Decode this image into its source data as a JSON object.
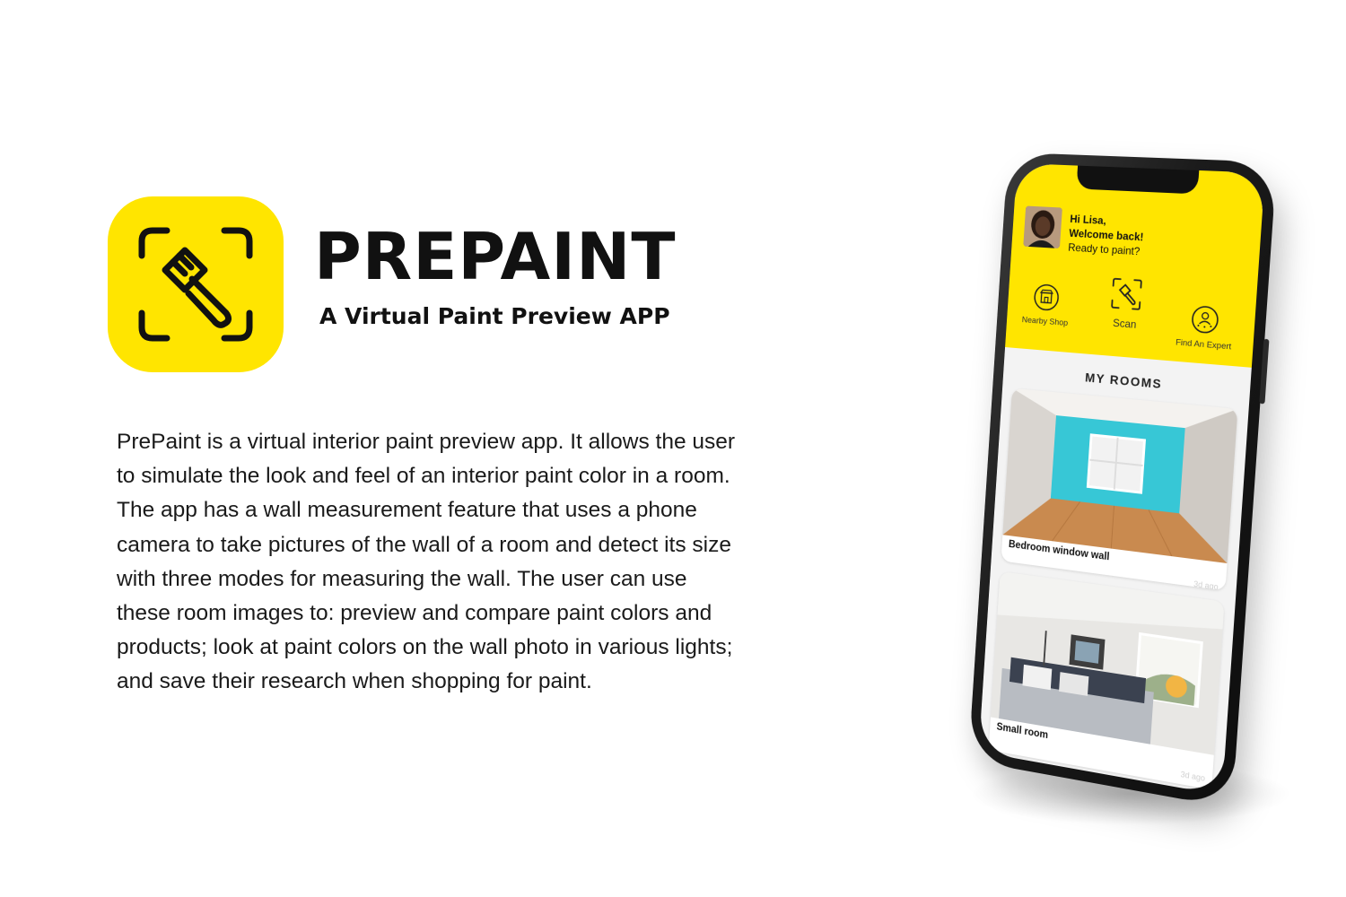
{
  "brand": {
    "name": "PREPAINT",
    "tagline": "A Virtual Paint Preview APP",
    "icon": "paintbrush-scan-icon",
    "accent_color": "#ffe500"
  },
  "description": "PrePaint is a virtual interior paint preview app. It allows the user to simulate the look and feel of an interior paint color in a room. The app has a wall measurement feature that uses a phone camera to take pictures of the wall of a room and detect its size with three modes for measuring the wall. The user can use these room images to: preview and compare paint colors and products; look at paint colors on the wall photo in various lights; and save their research when shopping for paint.",
  "phone": {
    "greeting": {
      "line1": "Hi Lisa,",
      "line2": "Welcome back!",
      "line3": "Ready to paint?"
    },
    "quick_actions": [
      {
        "label": "Nearby Shop",
        "icon": "shop-icon"
      },
      {
        "label": "Scan",
        "icon": "scan-brush-icon"
      },
      {
        "label": "Find An Expert",
        "icon": "expert-icon"
      }
    ],
    "rooms_title": "MY ROOMS",
    "rooms": [
      {
        "label": "Bedroom window wall",
        "meta": "3d ago"
      },
      {
        "label": "Small room",
        "meta": "3d ago"
      }
    ]
  }
}
